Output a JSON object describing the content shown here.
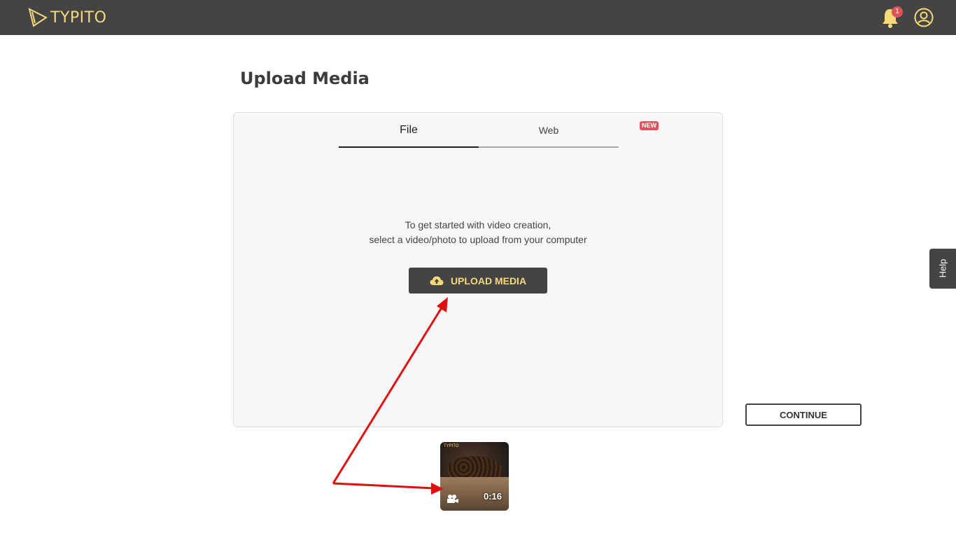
{
  "header": {
    "logo_text": "TYPITO",
    "notification_count": "1",
    "brand_color": "#f5d97a",
    "bar_color": "#444444"
  },
  "page": {
    "title": "Upload Media"
  },
  "tabs": [
    {
      "label": "File",
      "active": true
    },
    {
      "label": "Web",
      "badge": "NEW",
      "active": false
    }
  ],
  "upload": {
    "intro_line1": "To get started with video creation,",
    "intro_line2": "select a video/photo to upload from your computer",
    "button_label": "UPLOAD MEDIA",
    "icon": "cloud-upload-icon"
  },
  "continue_label": "CONTINUE",
  "help_label": "Help",
  "media_item": {
    "duration": "0:16",
    "mini_logo": "TYPITO",
    "type_icon": "video-camera-icon"
  },
  "annotation_color": "#e01010"
}
